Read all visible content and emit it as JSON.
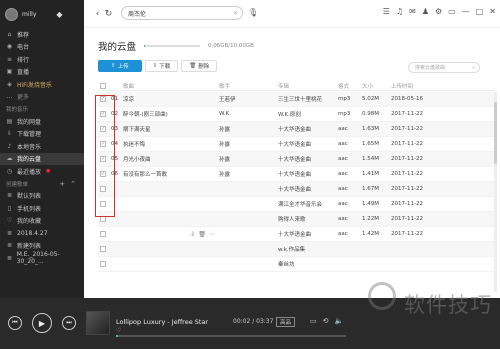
{
  "sidebar": {
    "username": "milly",
    "items": [
      {
        "label": "推荐",
        "icon": "home-icon"
      },
      {
        "label": "电台",
        "icon": "radio-icon"
      },
      {
        "label": "排行",
        "icon": "chart-icon"
      },
      {
        "label": "直播",
        "icon": "tv-icon"
      },
      {
        "label": "HiFi发烧音乐",
        "icon": "hifi-icon"
      },
      {
        "label": "更多",
        "icon": "more-icon"
      }
    ],
    "my_music_title": "我的音乐",
    "my_items": [
      {
        "label": "我的网盘",
        "icon": "folder-icon"
      },
      {
        "label": "下载管理",
        "icon": "download-icon"
      },
      {
        "label": "本地音乐",
        "icon": "music-icon"
      },
      {
        "label": "我的云盘",
        "icon": "cloud-icon",
        "active": true
      },
      {
        "label": "最近播放",
        "icon": "clock-icon",
        "dot": true
      }
    ],
    "playlist_title": "创建歌单",
    "playlists": [
      {
        "label": "默认列表",
        "icon": "list-icon"
      },
      {
        "label": "手机列表",
        "icon": "phone-icon"
      },
      {
        "label": "我的收藏",
        "icon": "heart-icon"
      },
      {
        "label": "2018.4.27",
        "icon": "list-icon"
      },
      {
        "label": "新建列表",
        "icon": "list-icon"
      },
      {
        "label": "M.E._2016-05-30_20_...",
        "icon": "list-icon"
      }
    ]
  },
  "topbar": {
    "search_value": "周杰伦"
  },
  "main": {
    "title": "我的云盘",
    "capacity_text": "0.06GB/10.00GB",
    "capacity_fraction": 0.006,
    "buttons": {
      "upload": "上传",
      "download": "下载",
      "delete": "删除"
    },
    "search_placeholder": "搜索云盘歌曲",
    "headers": {
      "name": "歌曲",
      "singer": "歌手",
      "album": "专辑",
      "format": "格式",
      "size": "大小",
      "date": "上传时间"
    },
    "rows": [
      {
        "num": "01",
        "name": "凉凉",
        "singer": "王若伊",
        "album": "三生三世十里桃花",
        "format": "mp3",
        "size": "5.02M",
        "date": "2018-05-16",
        "checked": true
      },
      {
        "num": "02",
        "name": "醉今朝-(剧三部曲)",
        "singer": "W.K.",
        "album": "W.K.原创",
        "format": "mp3",
        "size": "0.98M",
        "date": "2017-11-22",
        "checked": true
      },
      {
        "num": "03",
        "name": "摘下满天星",
        "singer": "孙露",
        "album": "十大华语金曲",
        "format": "aac",
        "size": "1.63M",
        "date": "2017-11-22",
        "checked": true
      },
      {
        "num": "04",
        "name": "执迷不悔",
        "singer": "孙露",
        "album": "十大华语金曲",
        "format": "aac",
        "size": "1.65M",
        "date": "2017-11-22",
        "checked": true
      },
      {
        "num": "05",
        "name": "月光小夜曲",
        "singer": "孙露",
        "album": "十大华语金曲",
        "format": "aac",
        "size": "1.54M",
        "date": "2017-11-22",
        "checked": true
      },
      {
        "num": "06",
        "name": "有没有那么一首歌",
        "singer": "孙露",
        "album": "十大华语金曲",
        "format": "aac",
        "size": "1.41M",
        "date": "2017-11-22",
        "checked": true
      },
      {
        "num": "",
        "name": "",
        "singer": "",
        "album": "十大华语金曲",
        "format": "aac",
        "size": "1.67M",
        "date": "2017-11-22",
        "checked": false,
        "blur": true
      },
      {
        "num": "",
        "name": "",
        "singer": "",
        "album": "满江全才华音乐会",
        "format": "aac",
        "size": "1.49M",
        "date": "2017-11-22",
        "checked": false,
        "blur": true
      },
      {
        "num": "",
        "name": "",
        "singer": "",
        "album": "购得人来歌",
        "format": "aac",
        "size": "1.22M",
        "date": "2017-11-22",
        "checked": false,
        "blur": true
      },
      {
        "num": "",
        "name": "",
        "singer": "",
        "album": "十大华语金曲",
        "format": "aac",
        "size": "1.42M",
        "date": "2017-11-22",
        "checked": false,
        "blur": true,
        "actions": true
      },
      {
        "num": "",
        "name": "",
        "singer": "",
        "album": "w.k.作品集",
        "format": "",
        "size": "",
        "date": "",
        "checked": false,
        "blur": true
      },
      {
        "num": "",
        "name": "",
        "singer": "",
        "album": "秦丝坊",
        "format": "",
        "size": "",
        "date": "",
        "checked": false,
        "blur": true
      }
    ]
  },
  "player": {
    "song": "Lollipop Luxury - Jeffree Star",
    "time": "00:02 / 03:37",
    "quality": "高品",
    "progress_fraction": 0.01
  },
  "watermark": "软件技巧",
  "colors": {
    "accent": "#31c27c",
    "primary_button": "#1e90d6",
    "highlight": "#d03030"
  }
}
